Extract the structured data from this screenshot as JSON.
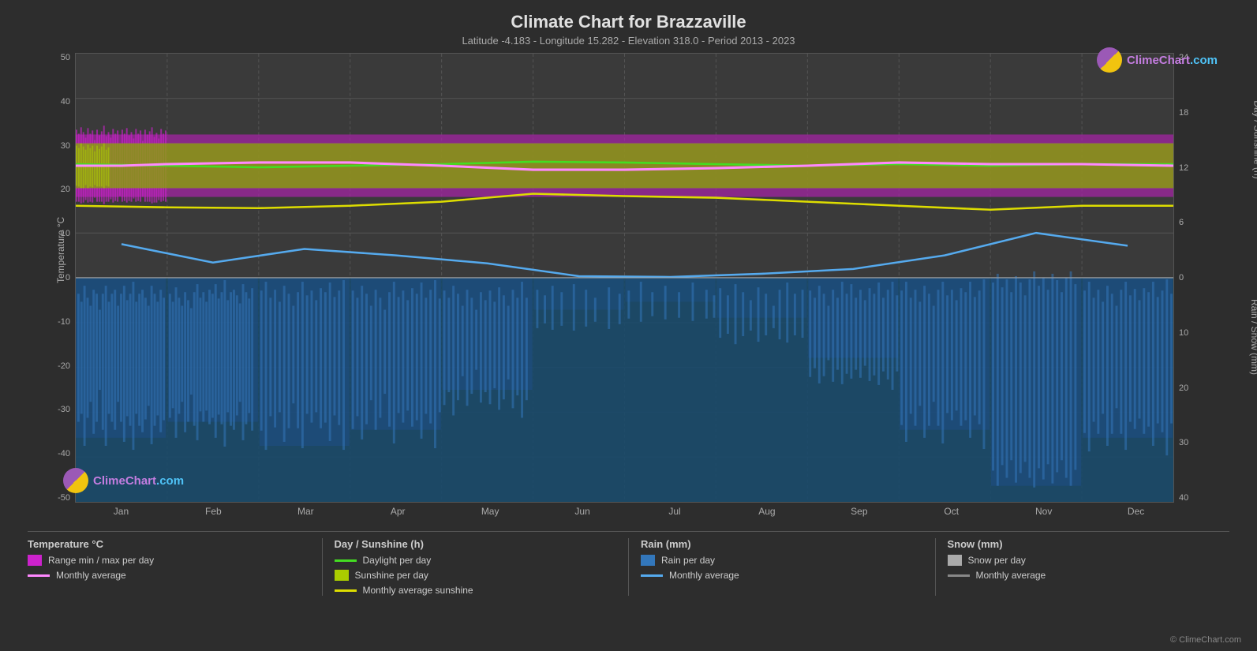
{
  "title": "Climate Chart for Brazzaville",
  "subtitle": "Latitude -4.183 - Longitude 15.282 - Elevation 318.0 - Period 2013 - 2023",
  "yaxis_left": {
    "label": "Temperature °C",
    "ticks": [
      "50",
      "40",
      "30",
      "20",
      "10",
      "0",
      "-10",
      "-20",
      "-30",
      "-40",
      "-50"
    ]
  },
  "yaxis_right_top": {
    "label": "Day / Sunshine (h)",
    "ticks": [
      "24",
      "18",
      "12",
      "6",
      "0"
    ]
  },
  "yaxis_right_bottom": {
    "label": "Rain / Snow (mm)",
    "ticks": [
      "0",
      "10",
      "20",
      "30",
      "40"
    ]
  },
  "xaxis": {
    "months": [
      "Jan",
      "Feb",
      "Mar",
      "Apr",
      "May",
      "Jun",
      "Jul",
      "Aug",
      "Sep",
      "Oct",
      "Nov",
      "Dec"
    ]
  },
  "legend": {
    "sections": [
      {
        "header": "Temperature °C",
        "items": [
          {
            "type": "swatch",
            "color": "#cc44cc",
            "label": "Range min / max per day"
          },
          {
            "type": "line",
            "color": "#ee77ee",
            "label": "Monthly average"
          }
        ]
      },
      {
        "header": "Day / Sunshine (h)",
        "items": [
          {
            "type": "line",
            "color": "#66dd44",
            "label": "Daylight per day"
          },
          {
            "type": "swatch",
            "color": "#aacc00",
            "label": "Sunshine per day"
          },
          {
            "type": "line",
            "color": "#dddd00",
            "label": "Monthly average sunshine"
          }
        ]
      },
      {
        "header": "Rain (mm)",
        "items": [
          {
            "type": "swatch",
            "color": "#3399cc",
            "label": "Rain per day"
          },
          {
            "type": "line",
            "color": "#55aadd",
            "label": "Monthly average"
          }
        ]
      },
      {
        "header": "Snow (mm)",
        "items": [
          {
            "type": "swatch",
            "color": "#aaaaaa",
            "label": "Snow per day"
          },
          {
            "type": "line",
            "color": "#888888",
            "label": "Monthly average"
          }
        ]
      }
    ]
  },
  "logo": {
    "text_clime": "Clime",
    "text_chart": "Chart",
    "text_com": ".com"
  },
  "copyright": "© ClimeChart.com"
}
